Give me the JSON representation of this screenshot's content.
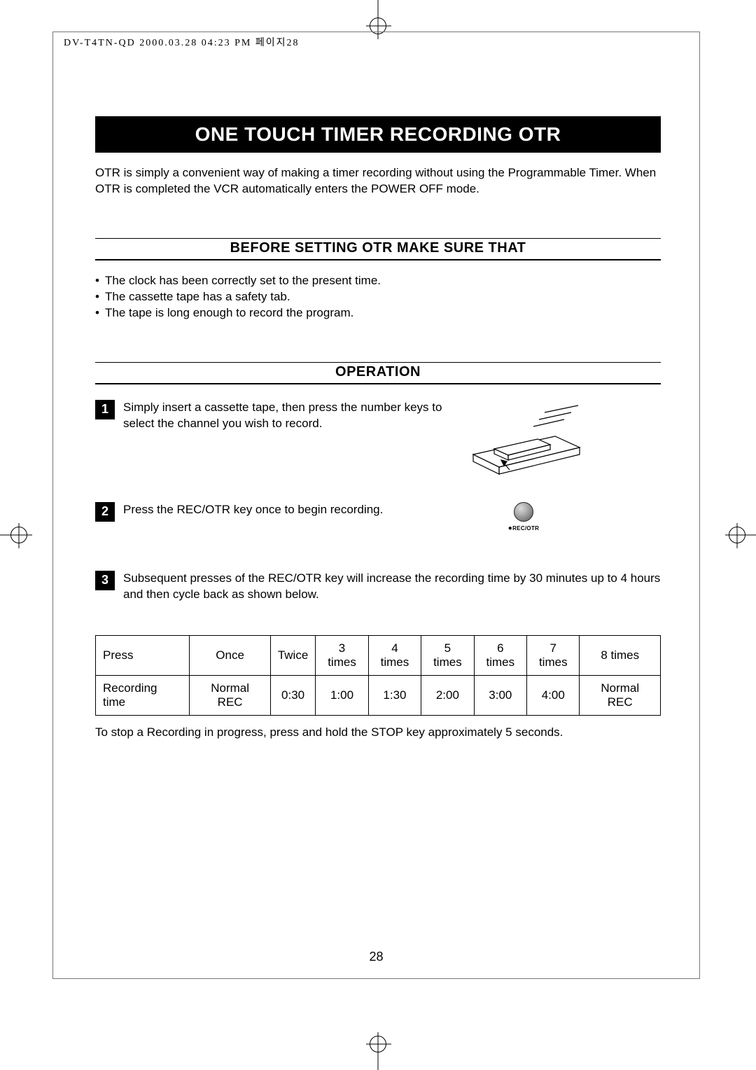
{
  "header_line": "DV-T4TN-QD  2000.03.28 04:23 PM  페이지28",
  "title": "ONE TOUCH TIMER RECORDING OTR",
  "intro": "OTR is simply a convenient way of making a timer recording without using the Programmable Timer. When OTR is completed the VCR automatically enters the POWER OFF mode.",
  "section1": {
    "heading": "BEFORE SETTING OTR MAKE SURE THAT",
    "bullets": [
      "The clock has been correctly set to the present time.",
      "The cassette tape has a safety tab.",
      "The tape is long enough to record the program."
    ]
  },
  "section2": {
    "heading": "OPERATION",
    "steps": [
      {
        "num": "1",
        "text": "Simply insert a cassette tape, then press the number keys to select the channel you wish to record."
      },
      {
        "num": "2",
        "text": "Press the REC/OTR key once to begin recording."
      },
      {
        "num": "3",
        "text": "Subsequent presses of the REC/OTR key will increase the recording time by 30 minutes up to 4 hours and then cycle back as shown below."
      }
    ],
    "rec_button_label": "REC/OTR"
  },
  "table": {
    "row_labels": [
      "Press",
      "Recording time"
    ],
    "columns": [
      "Once",
      "Twice",
      "3 times",
      "4 times",
      "5 times",
      "6 times",
      "7 times",
      "8 times"
    ],
    "values": [
      "Normal REC",
      "0:30",
      "1:00",
      "1:30",
      "2:00",
      "3:00",
      "4:00",
      "Normal REC"
    ]
  },
  "below_table": "To stop a Recording in progress, press and hold the STOP key approximately 5 seconds.",
  "page_number": "28"
}
